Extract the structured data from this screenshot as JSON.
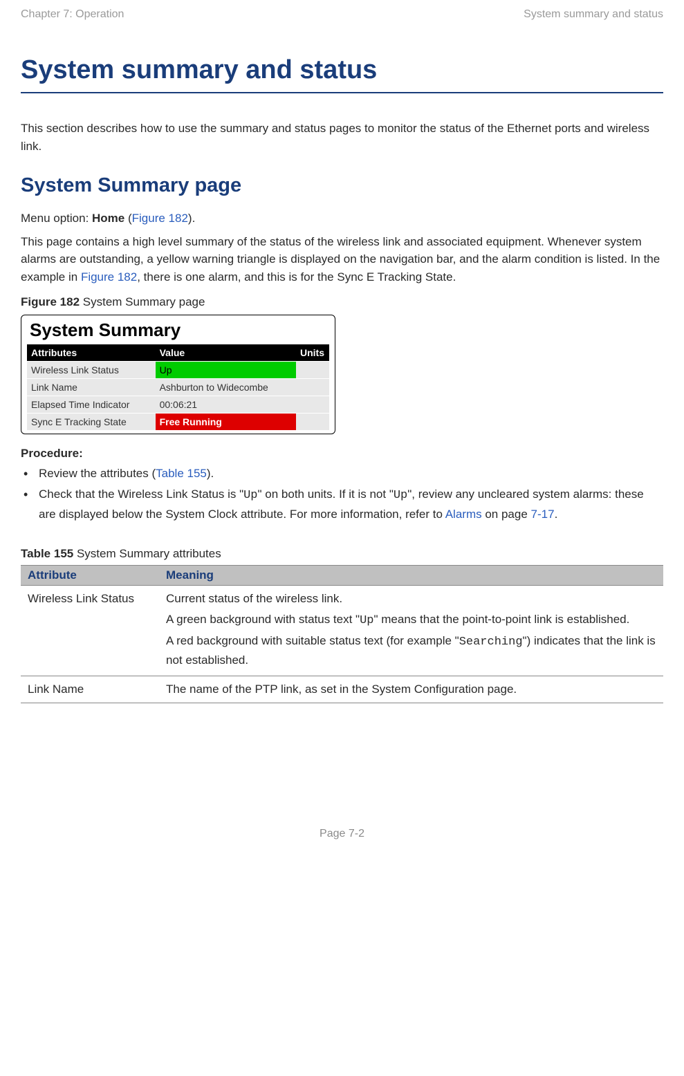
{
  "header": {
    "left": "Chapter 7:  Operation",
    "right": "System summary and status"
  },
  "main_title": "System summary and status",
  "intro": "This section describes how to use the summary and status pages to monitor the status of the Ethernet ports and wireless link.",
  "sub_title": "System Summary page",
  "menu_line_prefix": "Menu option: ",
  "menu_line_bold": "Home",
  "menu_line_open": " (",
  "menu_line_link": "Figure 182",
  "menu_line_close": ").",
  "desc_part1": "This page contains a high level summary of the status of the wireless link and associated equipment. Whenever system alarms are outstanding, a yellow warning triangle is displayed on the navigation bar, and the alarm condition is listed. In the example in ",
  "desc_link": "Figure 182",
  "desc_part2": ", there is one alarm, and this is for the Sync E Tracking State.",
  "figure_label_bold": "Figure 182",
  "figure_label_rest": "  System Summary page",
  "summary": {
    "title": "System Summary",
    "headers": {
      "attr": "Attributes",
      "value": "Value",
      "units": "Units"
    },
    "rows": [
      {
        "attr": "Wireless Link Status",
        "value": "Up",
        "units": "",
        "value_class": "cell-green"
      },
      {
        "attr": "Link Name",
        "value": "Ashburton to Widecombe",
        "units": "",
        "value_class": ""
      },
      {
        "attr": "Elapsed Time Indicator",
        "value": "00:06:21",
        "units": "",
        "value_class": ""
      },
      {
        "attr": "Sync E Tracking State",
        "value": "Free Running",
        "units": "",
        "value_class": "cell-red"
      }
    ]
  },
  "procedure_heading": "Procedure:",
  "bullets": {
    "b1_pre": "Review the attributes (",
    "b1_link": "Table 155",
    "b1_post": ").",
    "b2_pre": "Check that the Wireless Link Status is \"",
    "b2_mono1": "Up",
    "b2_mid1": "\" on both units. If it is not \"",
    "b2_mono2": "Up",
    "b2_mid2": "\", review any uncleared system alarms: these are displayed below the System Clock attribute. For more information, refer to ",
    "b2_link1": "Alarms",
    "b2_mid3": " on page ",
    "b2_link2": "7-17",
    "b2_post": "."
  },
  "table155": {
    "label_bold": "Table 155",
    "label_rest": "  System Summary attributes",
    "headers": {
      "attr": "Attribute",
      "meaning": "Meaning"
    },
    "rows": [
      {
        "attr": "Wireless Link Status",
        "p1": "Current status of the wireless link.",
        "p2_pre": "A green background with status text \"",
        "p2_mono": "Up",
        "p2_post": "\" means that the point-to-point link is established.",
        "p3_pre": "A red background with suitable status text (for example \"",
        "p3_mono": "Searching",
        "p3_post": "\") indicates that the link is not established."
      },
      {
        "attr": "Link Name",
        "p1": "The name of the PTP link, as set in the System Configuration page."
      }
    ]
  },
  "footer": "Page 7-2"
}
